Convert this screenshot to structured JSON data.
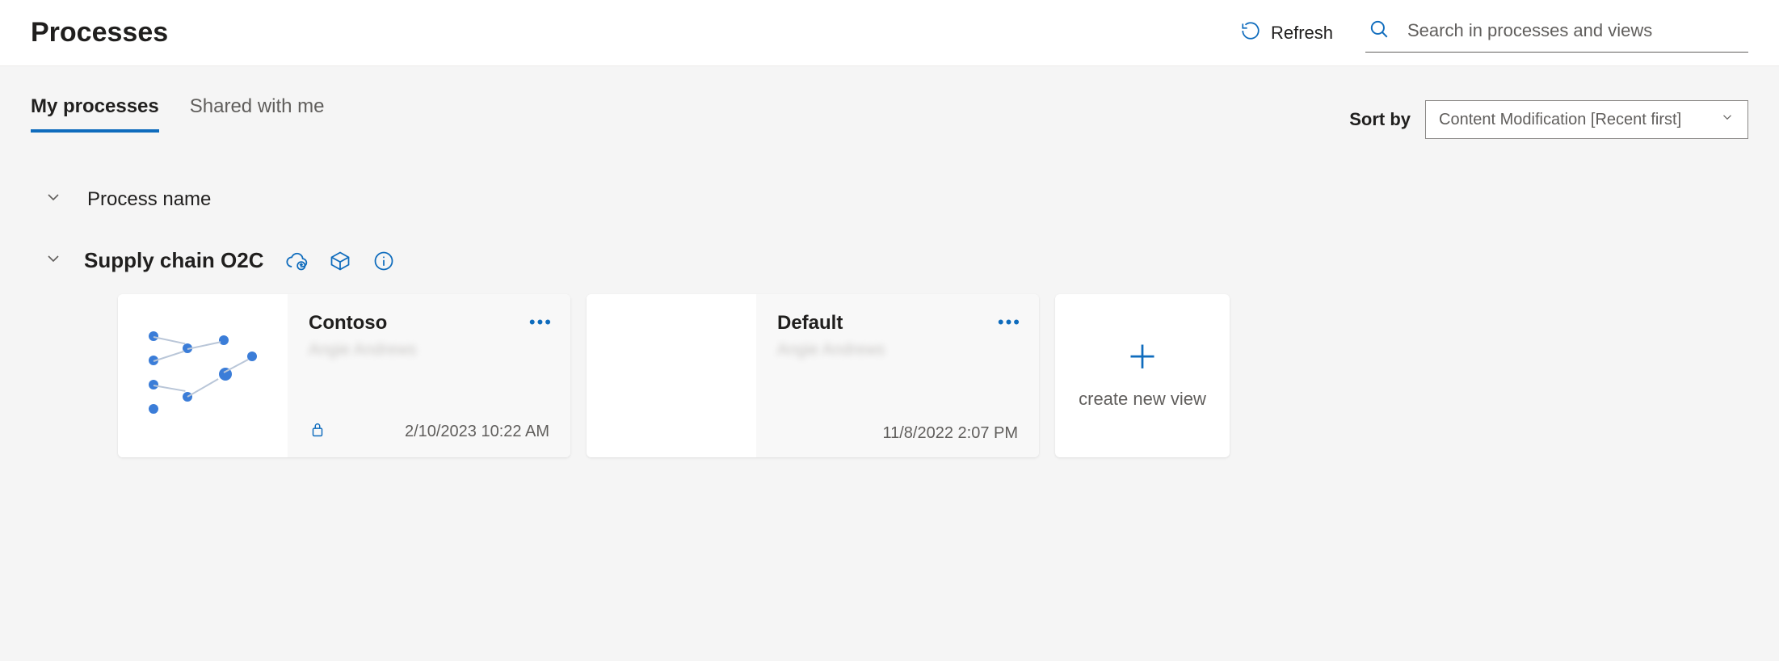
{
  "header": {
    "title": "Processes",
    "refresh_label": "Refresh",
    "search_placeholder": "Search in processes and views"
  },
  "tabs": {
    "my_processes": "My processes",
    "shared_with_me": "Shared with me"
  },
  "sort": {
    "label": "Sort by",
    "selected": "Content Modification [Recent first]"
  },
  "group": {
    "header": "Process name",
    "process_name": "Supply chain O2C"
  },
  "cards": [
    {
      "title": "Contoso",
      "owner": "Angie Andrews",
      "date": "2/10/2023 10:22 AM",
      "locked": true
    },
    {
      "title": "Default",
      "owner": "Angie Andrews",
      "date": "11/8/2022 2:07 PM",
      "locked": false
    }
  ],
  "new_view_label": "create new view"
}
